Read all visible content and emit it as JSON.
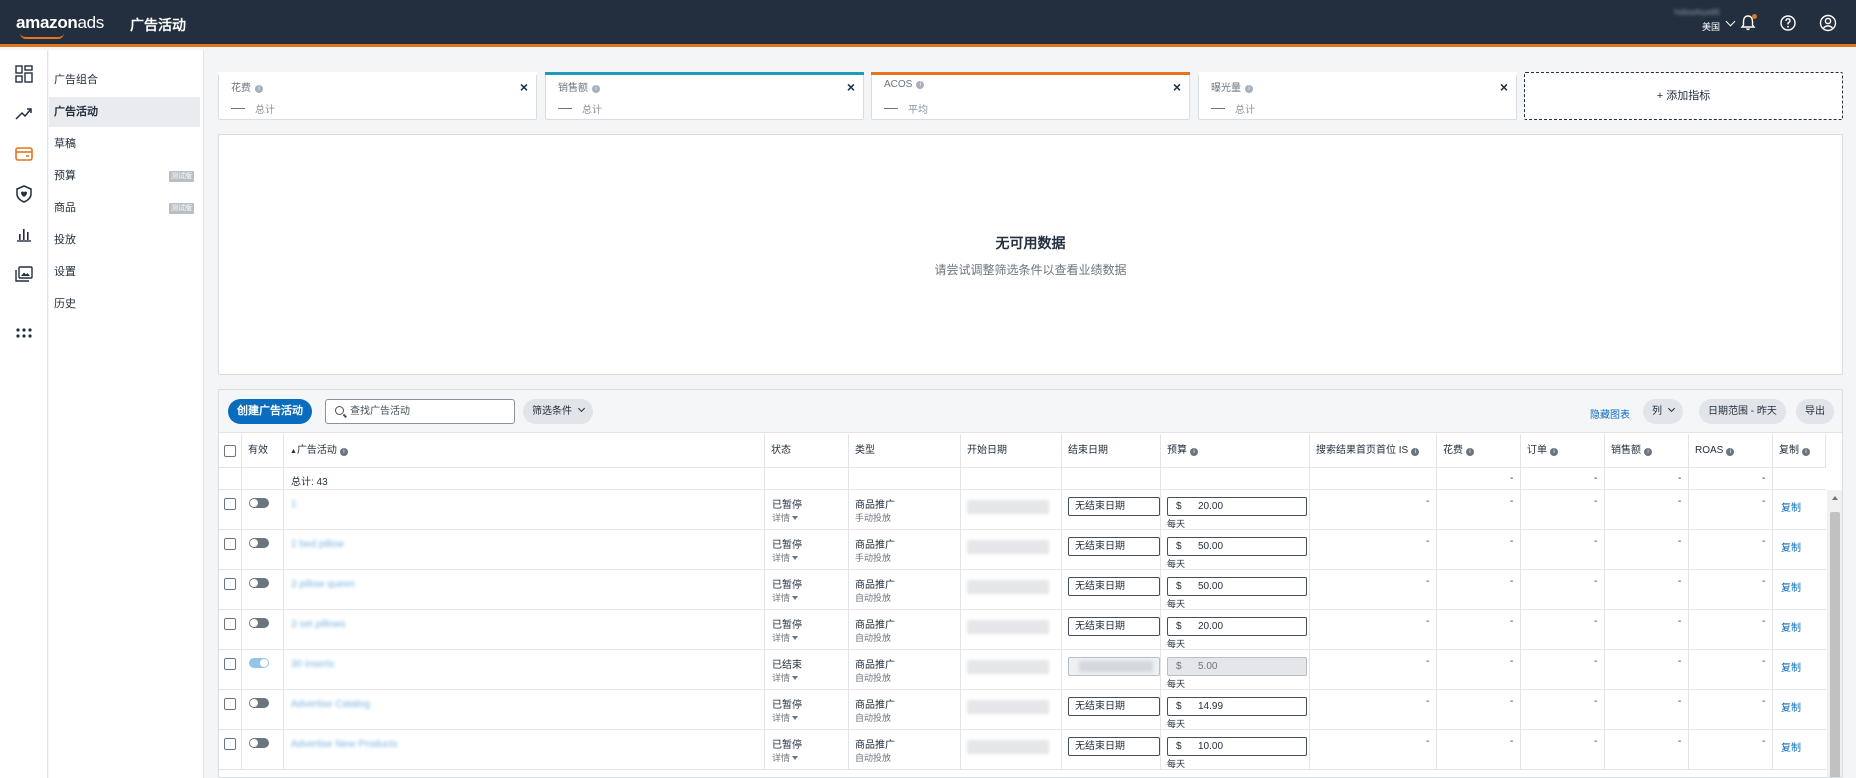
{
  "topbar": {
    "logo_main": "amazon",
    "logo_suffix": "ads",
    "app_title": "广告活动",
    "account_name": "Yellowfeye85",
    "account_country": "美国"
  },
  "sidebar": {
    "items": [
      {
        "label": "广告组合",
        "badge": ""
      },
      {
        "label": "广告活动",
        "badge": ""
      },
      {
        "label": "草稿",
        "badge": ""
      },
      {
        "label": "预算",
        "badge": "测试版"
      },
      {
        "label": "商品",
        "badge": "测试版"
      },
      {
        "label": "投放",
        "badge": ""
      },
      {
        "label": "设置",
        "badge": ""
      },
      {
        "label": "历史",
        "badge": ""
      }
    ]
  },
  "metrics": [
    {
      "name": "花费",
      "sub": "总计",
      "color": "#d9dde1"
    },
    {
      "name": "销售额",
      "sub": "总计",
      "color": "#1f9bb8"
    },
    {
      "name": "ACOS",
      "sub": "平均",
      "color": "#e3751c"
    },
    {
      "name": "曝光量",
      "sub": "总计",
      "color": "#d9dde1"
    }
  ],
  "add_metric_label": "+ 添加指标",
  "empty_state": {
    "title": "无可用数据",
    "subtitle": "请尝试调整筛选条件以查看业绩数据"
  },
  "toolbar": {
    "create_label": "创建广告活动",
    "search_placeholder": "查找广告活动",
    "filter_label": "筛选条件",
    "hide_chart_label": "隐藏图表",
    "columns_label": "列",
    "date_range_label": "日期范围 - 昨天",
    "export_label": "导出"
  },
  "table": {
    "headers": {
      "active": "有效",
      "campaign": "广告活动",
      "status": "状态",
      "type": "类型",
      "start_date": "开始日期",
      "end_date": "结束日期",
      "budget": "预算",
      "top_of_search": "搜索结果首页首位 IS",
      "spend": "花费",
      "orders": "订单",
      "sales": "销售额",
      "roas": "ROAS",
      "copy": "复制"
    },
    "total_label": "总计: 43",
    "dash": "-",
    "detail_label": "详情",
    "no_end_date": "无结束日期",
    "per_day": "每天",
    "currency": "$",
    "copy_label": "复制",
    "rows": [
      {
        "name": "1",
        "enabled": false,
        "status": "已暂停",
        "type": "商品推广",
        "targeting": "手动投放",
        "end": "none",
        "budget": "20.00",
        "budget_disabled": false
      },
      {
        "name": "2 bed pillow",
        "enabled": false,
        "status": "已暂停",
        "type": "商品推广",
        "targeting": "手动投放",
        "end": "none",
        "budget": "50.00",
        "budget_disabled": false
      },
      {
        "name": "3 pillow queen",
        "enabled": false,
        "status": "已暂停",
        "type": "商品推广",
        "targeting": "自动投放",
        "end": "none",
        "budget": "50.00",
        "budget_disabled": false
      },
      {
        "name": "3 set pillows",
        "enabled": false,
        "status": "已暂停",
        "type": "商品推广",
        "targeting": "自动投放",
        "end": "none",
        "budget": "20.00",
        "budget_disabled": false
      },
      {
        "name": "30 inserts",
        "enabled": true,
        "status": "已结束",
        "type": "商品推广",
        "targeting": "自动投放",
        "end": "date",
        "budget": "5.00",
        "budget_disabled": true
      },
      {
        "name": "Advertise Catalog",
        "enabled": false,
        "status": "已暂停",
        "type": "商品推广",
        "targeting": "自动投放",
        "end": "none",
        "budget": "14.99",
        "budget_disabled": false
      },
      {
        "name": "Advertise New Products",
        "enabled": false,
        "status": "已暂停",
        "type": "商品推广",
        "targeting": "自动投放",
        "end": "none",
        "budget": "10.00",
        "budget_disabled": false
      }
    ]
  }
}
